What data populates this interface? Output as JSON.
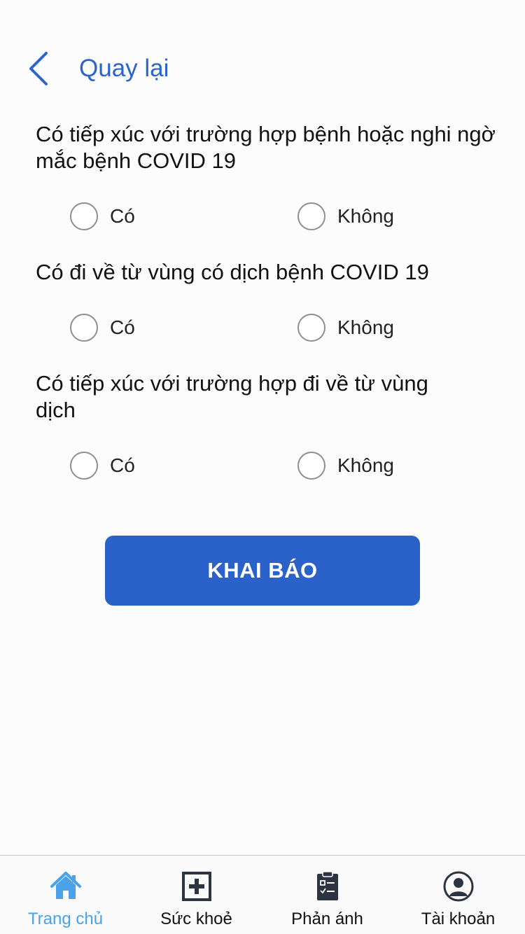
{
  "header": {
    "back_label": "Quay lại"
  },
  "questions": [
    {
      "text": "Có tiếp xúc với trường hợp bệnh hoặc nghi ngờ mắc bệnh COVID 19",
      "options": [
        "Có",
        "Không"
      ]
    },
    {
      "text": "Có đi về từ vùng có dịch bệnh COVID 19",
      "options": [
        "Có",
        "Không"
      ]
    },
    {
      "text": "Có tiếp xúc với trường hợp đi về từ vùng dịch",
      "options": [
        "Có",
        "Không"
      ]
    }
  ],
  "submit_label": "KHAI BÁO",
  "tabbar": {
    "items": [
      {
        "label": "Trang chủ",
        "icon": "home-icon",
        "active": true
      },
      {
        "label": "Sức khoẻ",
        "icon": "medical-cross-icon",
        "active": false
      },
      {
        "label": "Phản ánh",
        "icon": "clipboard-icon",
        "active": false
      },
      {
        "label": "Tài khoản",
        "icon": "user-account-icon",
        "active": false
      }
    ]
  },
  "colors": {
    "accent": "#2a64cc",
    "button": "#2a62c9",
    "tab_active": "#4aa3e8"
  }
}
